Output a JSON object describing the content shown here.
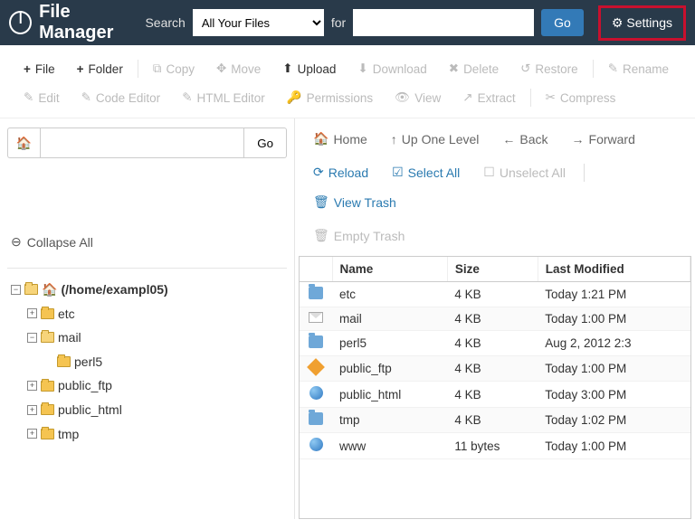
{
  "header": {
    "title": "File Manager",
    "search_label": "Search",
    "dropdown_selected": "All Your Files",
    "for_label": "for",
    "search_value": "",
    "go_label": "Go",
    "settings_label": "Settings"
  },
  "toolbar": {
    "file": "File",
    "folder": "Folder",
    "copy": "Copy",
    "move": "Move",
    "upload": "Upload",
    "download": "Download",
    "delete": "Delete",
    "restore": "Restore",
    "rename": "Rename",
    "edit": "Edit",
    "code_editor": "Code Editor",
    "html_editor": "HTML Editor",
    "permissions": "Permissions",
    "view": "View",
    "extract": "Extract",
    "compress": "Compress"
  },
  "sidebar": {
    "path_value": "",
    "go_label": "Go",
    "collapse_label": "Collapse All",
    "root_label": "(/home/exampl05)",
    "tree": [
      {
        "name": "etc",
        "expandable": true
      },
      {
        "name": "mail",
        "expandable": true,
        "open": true,
        "children": [
          {
            "name": "perl5",
            "expandable": false
          }
        ]
      },
      {
        "name": "public_ftp",
        "expandable": true
      },
      {
        "name": "public_html",
        "expandable": true
      },
      {
        "name": "tmp",
        "expandable": true
      }
    ]
  },
  "panel_toolbar": {
    "home": "Home",
    "up": "Up One Level",
    "back": "Back",
    "forward": "Forward",
    "reload": "Reload",
    "select_all": "Select All",
    "unselect_all": "Unselect All",
    "view_trash": "View Trash",
    "empty_trash": "Empty Trash"
  },
  "table": {
    "columns": [
      "Name",
      "Size",
      "Last Modified"
    ],
    "rows": [
      {
        "icon": "folder",
        "name": "etc",
        "size": "4 KB",
        "modified": "Today 1:21 PM"
      },
      {
        "icon": "mail",
        "name": "mail",
        "size": "4 KB",
        "modified": "Today 1:00 PM"
      },
      {
        "icon": "folder",
        "name": "perl5",
        "size": "4 KB",
        "modified": "Aug 2, 2012 2:3"
      },
      {
        "icon": "diamond",
        "name": "public_ftp",
        "size": "4 KB",
        "modified": "Today 1:00 PM"
      },
      {
        "icon": "globe",
        "name": "public_html",
        "size": "4 KB",
        "modified": "Today 3:00 PM"
      },
      {
        "icon": "folder",
        "name": "tmp",
        "size": "4 KB",
        "modified": "Today 1:02 PM"
      },
      {
        "icon": "globe",
        "name": "www",
        "size": "11 bytes",
        "modified": "Today 1:00 PM"
      }
    ]
  }
}
